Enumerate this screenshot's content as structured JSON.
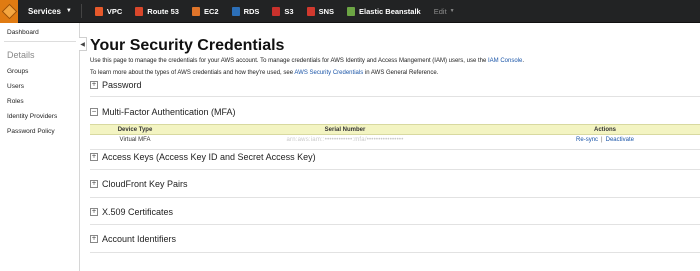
{
  "topbar": {
    "services_label": "Services",
    "items": [
      {
        "label": "VPC",
        "icon": "vpc-icon",
        "color": "#e7592b"
      },
      {
        "label": "Route 53",
        "icon": "route53-icon",
        "color": "#d9472b"
      },
      {
        "label": "EC2",
        "icon": "ec2-icon",
        "color": "#e0752a"
      },
      {
        "label": "RDS",
        "icon": "rds-icon",
        "color": "#2c6fb8"
      },
      {
        "label": "S3",
        "icon": "s3-icon",
        "color": "#c9312c"
      },
      {
        "label": "SNS",
        "icon": "sns-icon",
        "color": "#d1392e"
      },
      {
        "label": "Elastic Beanstalk",
        "icon": "elastic-beanstalk-icon",
        "color": "#6ca544"
      }
    ],
    "edit_label": "Edit"
  },
  "sidebar": {
    "dashboard": "Dashboard",
    "heading": "Details",
    "links": [
      "Groups",
      "Users",
      "Roles",
      "Identity Providers",
      "Password Policy"
    ]
  },
  "main": {
    "title": "Your Security Credentials",
    "desc1_text": "Use this page to manage the credentials for your AWS account. To manage credentials for AWS Identity and Access Mangement (IAM) users, use the",
    "desc1_link": "IAM Console",
    "desc1_end": ".",
    "desc2_text": "To learn more about the types of AWS credentials and how they're used, see",
    "desc2_link": "AWS Security Credentials",
    "desc2_end": "in AWS General Reference.",
    "sections": {
      "password": "Password",
      "mfa": "Multi-Factor Authentication (MFA)",
      "access_keys": "Access Keys (Access Key ID and Secret Access Key)",
      "cloudfront": "CloudFront Key Pairs",
      "x509": "X.509 Certificates",
      "account_ids": "Account Identifiers"
    },
    "mfa_table": {
      "headers": {
        "device_type": "Device Type",
        "serial": "Serial Number",
        "actions": "Actions"
      },
      "row": {
        "device_type": "Virtual MFA",
        "serial": "arn:aws:iam::••••••••••••:mfa/••••••••••••••••",
        "resync": "Re-sync",
        "separator": "|",
        "deactivate": "Deactivate"
      }
    }
  }
}
